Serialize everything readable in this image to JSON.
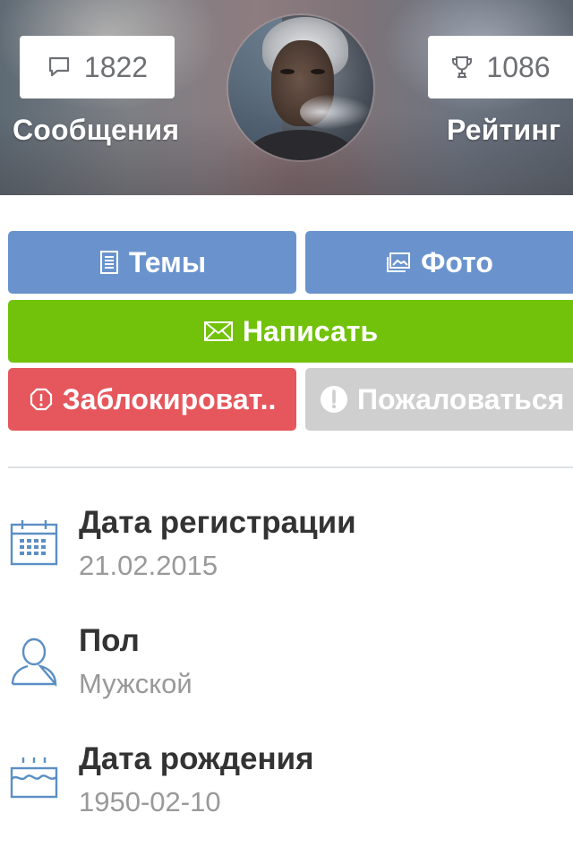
{
  "profile": {
    "messages": {
      "count": "1822",
      "label": "Сообщения",
      "icon": "speech-bubble-icon"
    },
    "rating": {
      "count": "1086",
      "label": "Рейтинг",
      "icon": "trophy-icon"
    },
    "avatar": "user-avatar"
  },
  "actions": {
    "topics": {
      "label": "Темы",
      "icon": "document-icon"
    },
    "photo": {
      "label": "Фото",
      "icon": "photos-icon"
    },
    "write": {
      "label": "Написать",
      "icon": "envelope-icon"
    },
    "block": {
      "label": "Заблокироват..",
      "icon": "block-icon"
    },
    "report": {
      "label": "Пожаловаться",
      "icon": "exclamation-icon"
    }
  },
  "info": [
    {
      "title": "Дата регистрации",
      "value": "21.02.2015",
      "icon": "calendar-icon"
    },
    {
      "title": "Пол",
      "value": "Мужской",
      "icon": "person-icon"
    },
    {
      "title": "Дата рождения",
      "value": "1950-02-10",
      "icon": "birthday-cake-icon"
    }
  ],
  "colors": {
    "primary_blue": "#6a93cd",
    "write_green": "#72c20b",
    "block_red": "#e5575d",
    "report_gray": "#cfcfcf",
    "icon_blue": "#5b8fc4",
    "title_text": "#333333",
    "value_text": "#999999"
  }
}
